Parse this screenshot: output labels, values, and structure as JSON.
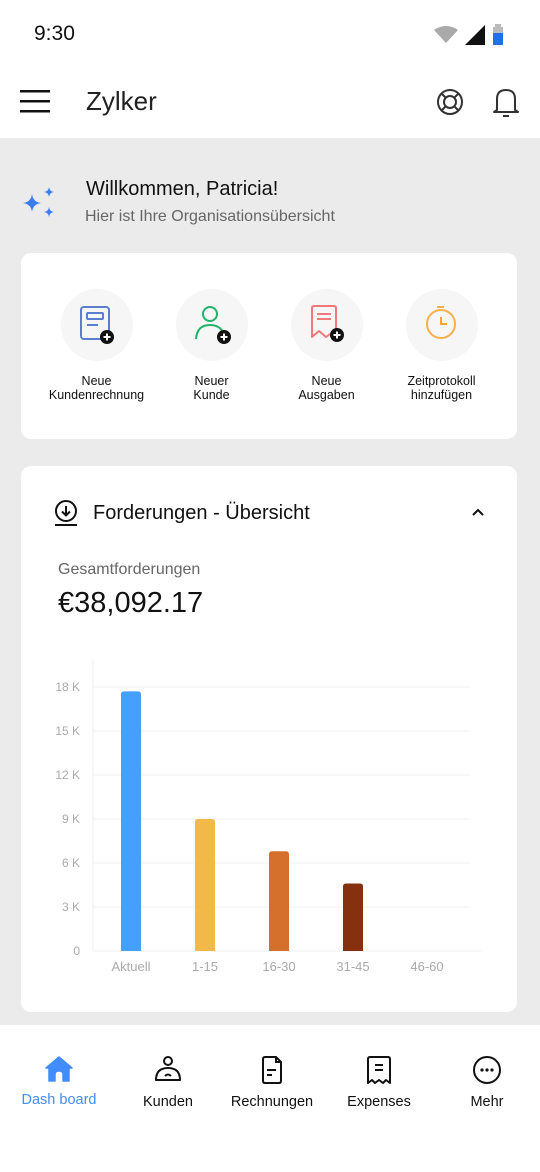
{
  "status_bar": {
    "time": "9:30",
    "battery_color": "#1a73e8"
  },
  "app_bar": {
    "title": "Zylker",
    "icons": [
      "menu-icon",
      "help-lifebuoy-icon",
      "bell-icon"
    ]
  },
  "welcome": {
    "title": "Willkommen, Patricia!",
    "subtitle": "Hier ist Ihre Organisationsübersicht",
    "icon": "sparkle-icon",
    "accent": "#3b7ded"
  },
  "quick_actions": [
    {
      "line1": "Neue",
      "line2": "Kundenrechnung",
      "icon": "invoice-add-icon",
      "color": "#5a7fcf"
    },
    {
      "line1": "Neuer",
      "line2": "Kunde",
      "icon": "customer-add-icon",
      "color": "#1fb36b"
    },
    {
      "line1": "Neue",
      "line2": "Ausgaben",
      "icon": "expense-add-icon",
      "color": "#f2787c"
    },
    {
      "line1": "Zeitprotokoll",
      "line2": "hinzufügen",
      "icon": "timer-icon",
      "color": "#f5b04d"
    }
  ],
  "receivables": {
    "title": "Forderungen - Übersicht",
    "total_label": "Gesamtforderungen",
    "total_value": "€38,092.17",
    "expanded": true
  },
  "chart_data": {
    "type": "bar",
    "title": "",
    "xlabel": "",
    "ylabel": "",
    "categories": [
      "Aktuell",
      "1-15",
      "16-30",
      "31-45",
      "46-60"
    ],
    "values": [
      17700,
      9000,
      6800,
      4600,
      0
    ],
    "colors": [
      "#449ffd",
      "#f3b948",
      "#d4702c",
      "#85300f",
      "#cccccc"
    ],
    "ylim": [
      0,
      18000
    ],
    "yticks": [
      0,
      3000,
      6000,
      9000,
      12000,
      15000,
      18000
    ],
    "ytick_labels": [
      "0",
      "3 K",
      "6 K",
      "9 K",
      "12 K",
      "15 K",
      "18 K"
    ],
    "grid": true,
    "legend": "none"
  },
  "bottom_nav": [
    {
      "label": "Dash board",
      "icon": "home-icon",
      "active": true
    },
    {
      "label": "Kunden",
      "icon": "customers-icon",
      "active": false
    },
    {
      "label": "Rechnungen",
      "icon": "invoices-icon",
      "active": false
    },
    {
      "label": "Expenses",
      "icon": "expenses-icon",
      "active": false
    },
    {
      "label": "Mehr",
      "icon": "more-icon",
      "active": false
    }
  ],
  "active_color": "#408dfb"
}
